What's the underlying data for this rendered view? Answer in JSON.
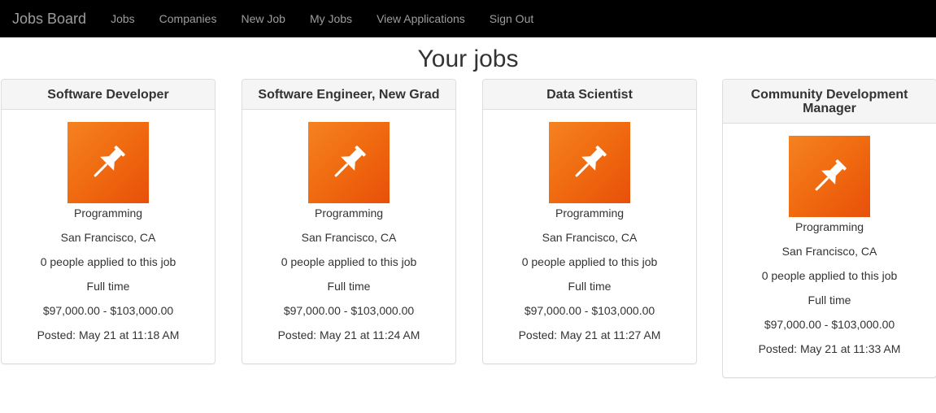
{
  "nav": {
    "brand": "Jobs Board",
    "links": [
      "Jobs",
      "Companies",
      "New Job",
      "My Jobs",
      "View Applications",
      "Sign Out"
    ]
  },
  "page_title": "Your jobs",
  "icon": "pushpin-icon",
  "colors": {
    "navbar": "#000000",
    "icon_bg": "#f06a10",
    "panel_heading": "#f5f5f5"
  },
  "jobs": [
    {
      "title": "Software Developer",
      "category": "Programming",
      "location": "San Francisco, CA",
      "applicants": "0 people applied to this job",
      "type": "Full time",
      "salary": "$97,000.00 - $103,000.00",
      "posted": "Posted: May 21 at 11:18 AM"
    },
    {
      "title": "Software Engineer, New Grad",
      "category": "Programming",
      "location": "San Francisco, CA",
      "applicants": "0 people applied to this job",
      "type": "Full time",
      "salary": "$97,000.00 - $103,000.00",
      "posted": "Posted: May 21 at 11:24 AM"
    },
    {
      "title": "Data Scientist",
      "category": "Programming",
      "location": "San Francisco, CA",
      "applicants": "0 people applied to this job",
      "type": "Full time",
      "salary": "$97,000.00 - $103,000.00",
      "posted": "Posted: May 21 at 11:27 AM"
    },
    {
      "title": "Community Development Manager",
      "category": "Programming",
      "location": "San Francisco, CA",
      "applicants": "0 people applied to this job",
      "type": "Full time",
      "salary": "$97,000.00 - $103,000.00",
      "posted": "Posted: May 21 at 11:33 AM"
    }
  ]
}
